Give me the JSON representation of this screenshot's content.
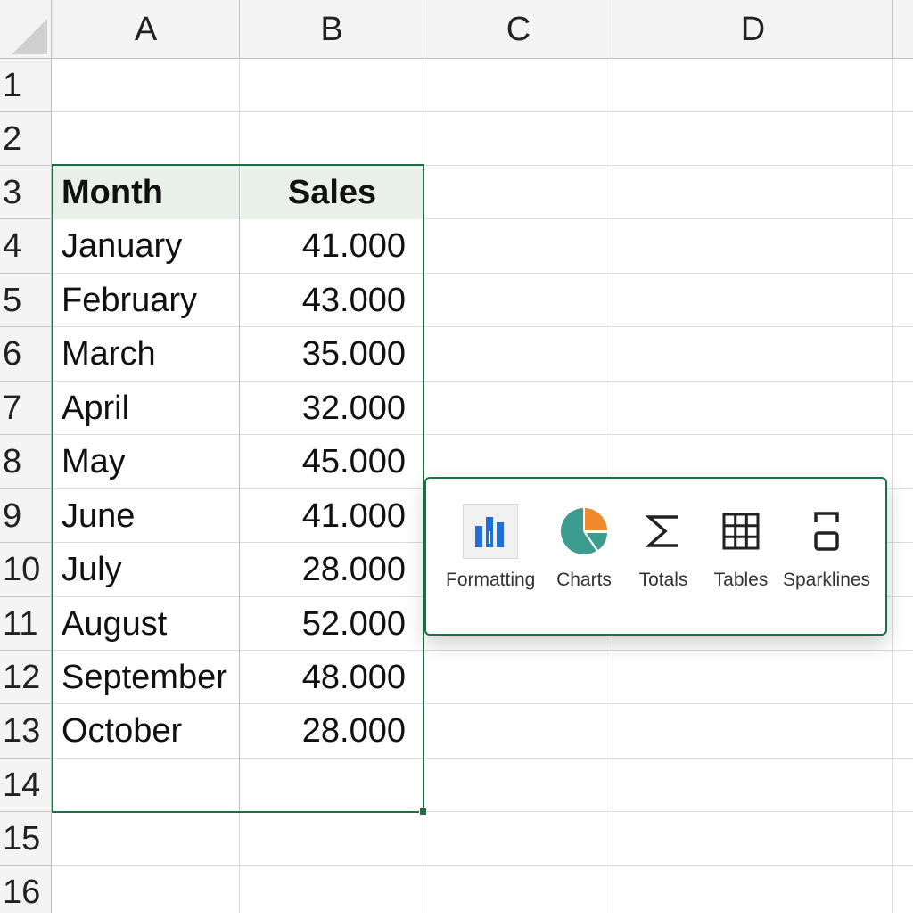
{
  "columns": [
    "A",
    "B",
    "C",
    "D"
  ],
  "rows": [
    "1",
    "2",
    "3",
    "4",
    "5",
    "6",
    "7",
    "8",
    "9",
    "10",
    "11",
    "12",
    "13",
    "14",
    "15",
    "16"
  ],
  "table": {
    "header": {
      "month": "Month",
      "sales": "Sales"
    },
    "rows": [
      {
        "month": "January",
        "sales": "41.000"
      },
      {
        "month": "February",
        "sales": "43.000"
      },
      {
        "month": "March",
        "sales": "35.000"
      },
      {
        "month": "April",
        "sales": "32.000"
      },
      {
        "month": "May",
        "sales": "45.000"
      },
      {
        "month": "June",
        "sales": "41.000"
      },
      {
        "month": "July",
        "sales": "28.000"
      },
      {
        "month": "August",
        "sales": "52.000"
      },
      {
        "month": "September",
        "sales": "48.000"
      },
      {
        "month": "October",
        "sales": "28.000"
      }
    ]
  },
  "quick_analysis": {
    "items": [
      {
        "label": "Formatting",
        "icon": "bar-formatting-icon",
        "selected": true
      },
      {
        "label": "Charts",
        "icon": "pie-chart-icon",
        "selected": false
      },
      {
        "label": "Totals",
        "icon": "sigma-icon",
        "selected": false
      },
      {
        "label": "Tables",
        "icon": "table-grid-icon",
        "selected": false
      },
      {
        "label": "Sparklines",
        "icon": "sparkline-icon",
        "selected": false
      }
    ]
  },
  "colors": {
    "selection": "#1f6e43",
    "header_fill": "#e9f0e9",
    "bar_blue": "#1f6fd6",
    "pie_teal": "#3b9c8f",
    "pie_orange": "#f08a2c"
  }
}
